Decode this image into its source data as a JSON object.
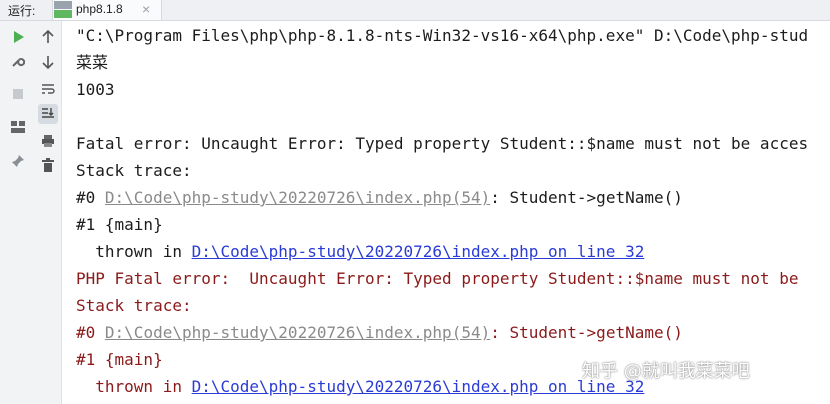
{
  "header": {
    "run_label": "运行:",
    "tab_title": "php8.1.8",
    "close_symbol": "×"
  },
  "console": {
    "lines": [
      {
        "text": "\"C:\\Program Files\\php\\php-8.1.8-nts-Win32-vs16-x64\\php.exe\" D:\\Code\\php-stud"
      },
      {
        "text": "菜菜"
      },
      {
        "text": "1003"
      },
      {
        "text": ""
      },
      {
        "text": "Fatal error: Uncaught Error: Typed property Student::$name must not be acces"
      },
      {
        "text": "Stack trace:"
      },
      {
        "prefix": "#0 ",
        "link": "D:\\Code\\php-study\\20220726\\index.php(54)",
        "suffix": ": Student->getName()"
      },
      {
        "text": "#1 {main}"
      },
      {
        "prefix": "  thrown in ",
        "link": "D:\\Code\\php-study\\20220726\\index.php on line 32"
      },
      {
        "text": "PHP Fatal error:  Uncaught Error: Typed property Student::$name must not be"
      },
      {
        "text": "Stack trace:"
      },
      {
        "prefix": "#0 ",
        "link": "D:\\Code\\php-study\\20220726\\index.php(54)",
        "suffix": ": Student->getName()"
      },
      {
        "text": "#1 {main}"
      },
      {
        "prefix": "  thrown in ",
        "link": "D:\\Code\\php-study\\20220726\\index.php on line 32"
      }
    ]
  },
  "watermark": "知乎 @就叫我菜菜吧",
  "colors": {
    "normal_text": "#1c1c1c",
    "error_text": "#8b1a1a",
    "link_gray": "#8a8a8a",
    "link_blue": "#2a3bd6",
    "run_green": "#4caf50"
  },
  "toolbar_icons": [
    "run-icon",
    "wrench-icon",
    "stop-icon",
    "layout-icon",
    "pin-icon",
    "arrow-up-icon",
    "arrow-down-icon",
    "soft-wrap-icon",
    "scroll-to-end-icon",
    "print-icon",
    "trash-icon"
  ]
}
